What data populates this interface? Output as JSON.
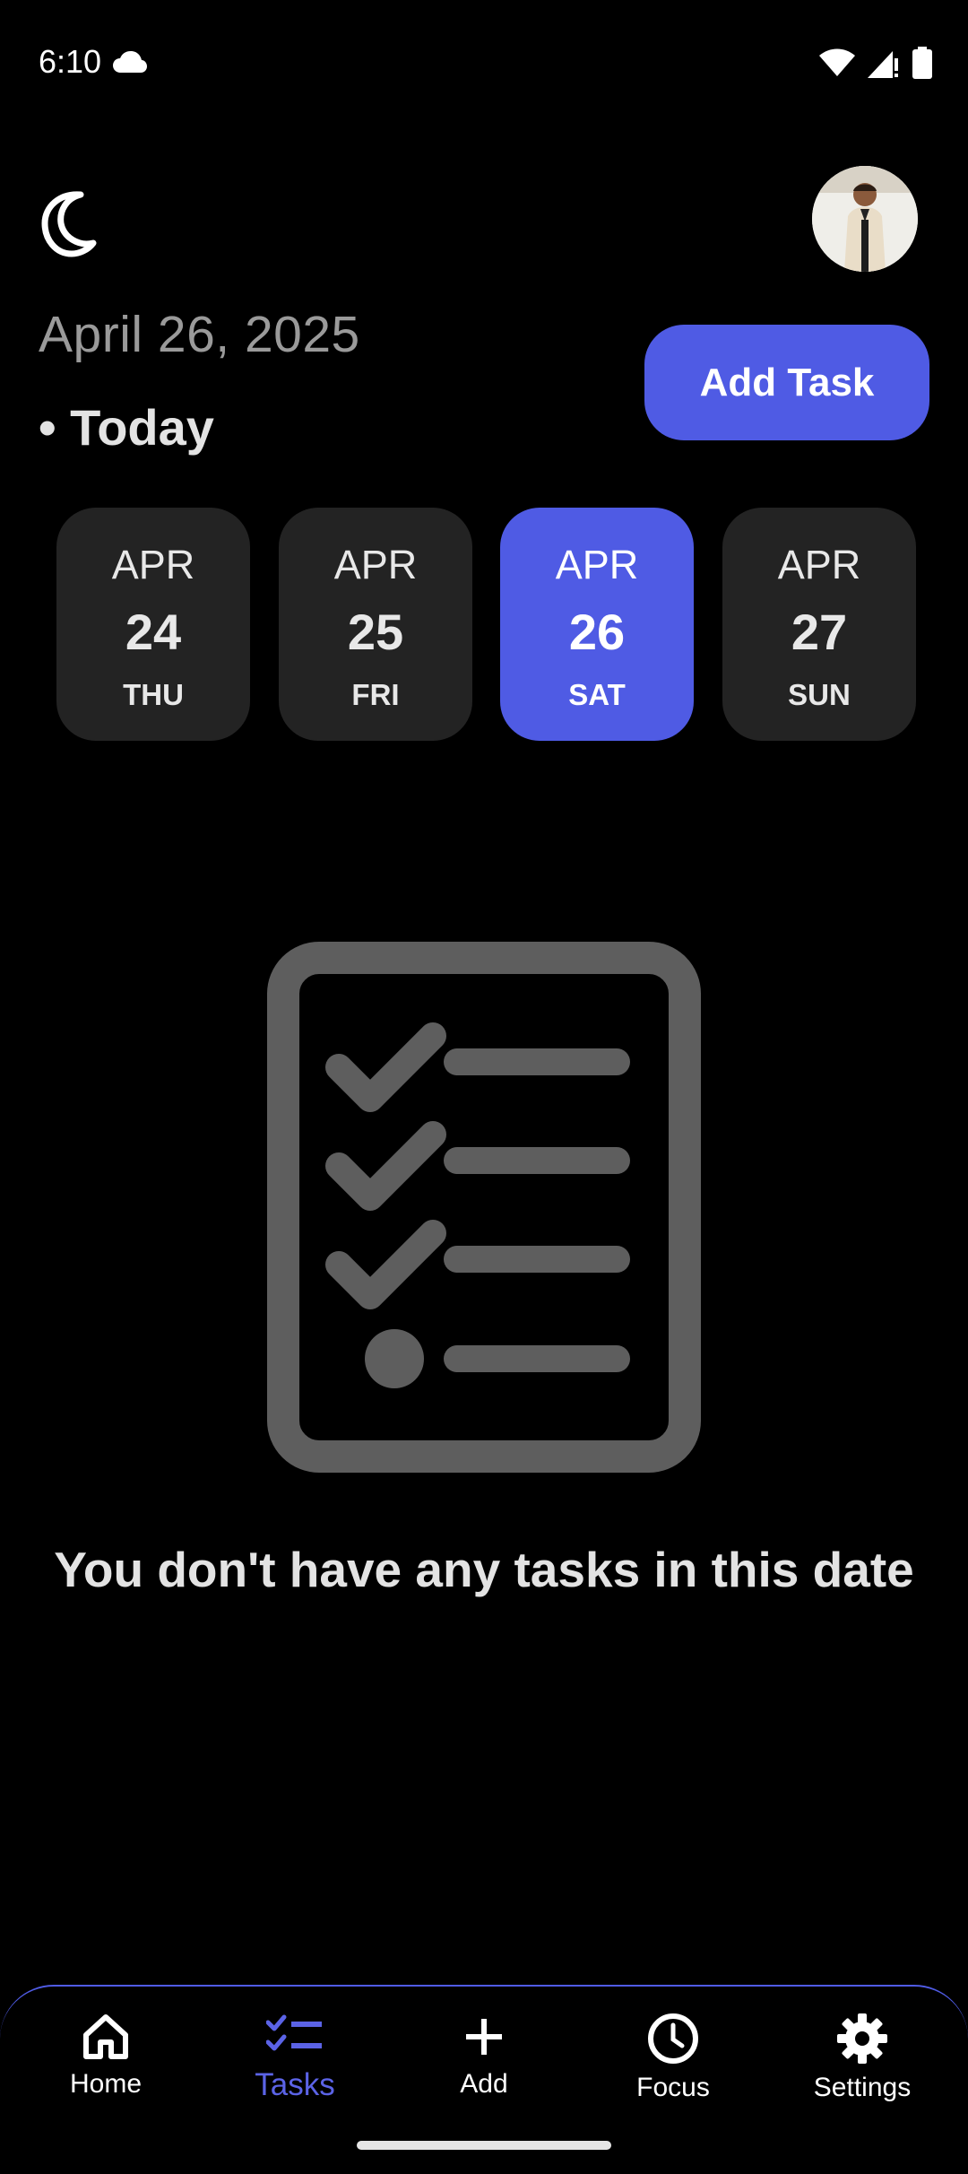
{
  "status_bar": {
    "time": "6:10",
    "icons": [
      "cloud-icon",
      "wifi-icon",
      "signal-icon",
      "battery-icon"
    ]
  },
  "header": {
    "theme_icon": "moon-icon",
    "avatar": "user-avatar"
  },
  "date": {
    "full": "April 26, 2025",
    "today_label": "• Today"
  },
  "add_task_label": "Add Task",
  "day_picker": [
    {
      "month": "APR",
      "day": "24",
      "weekday": "THU",
      "selected": false
    },
    {
      "month": "APR",
      "day": "25",
      "weekday": "FRI",
      "selected": false
    },
    {
      "month": "APR",
      "day": "26",
      "weekday": "SAT",
      "selected": true
    },
    {
      "month": "APR",
      "day": "27",
      "weekday": "SUN",
      "selected": false
    }
  ],
  "empty_state": {
    "icon": "checklist-icon",
    "message": "You don't have any tasks in this date"
  },
  "bottom_nav": [
    {
      "label": "Home",
      "icon": "home-icon",
      "active": false
    },
    {
      "label": "Tasks",
      "icon": "tasks-icon",
      "active": true
    },
    {
      "label": "Add",
      "icon": "plus-icon",
      "active": false
    },
    {
      "label": "Focus",
      "icon": "clock-icon",
      "active": false
    },
    {
      "label": "Settings",
      "icon": "gear-icon",
      "active": false
    }
  ],
  "colors": {
    "accent": "#4f5be4",
    "background": "#000000",
    "card": "#232323",
    "muted_text": "#9a9a9a",
    "illustration": "#5e5e5e"
  }
}
